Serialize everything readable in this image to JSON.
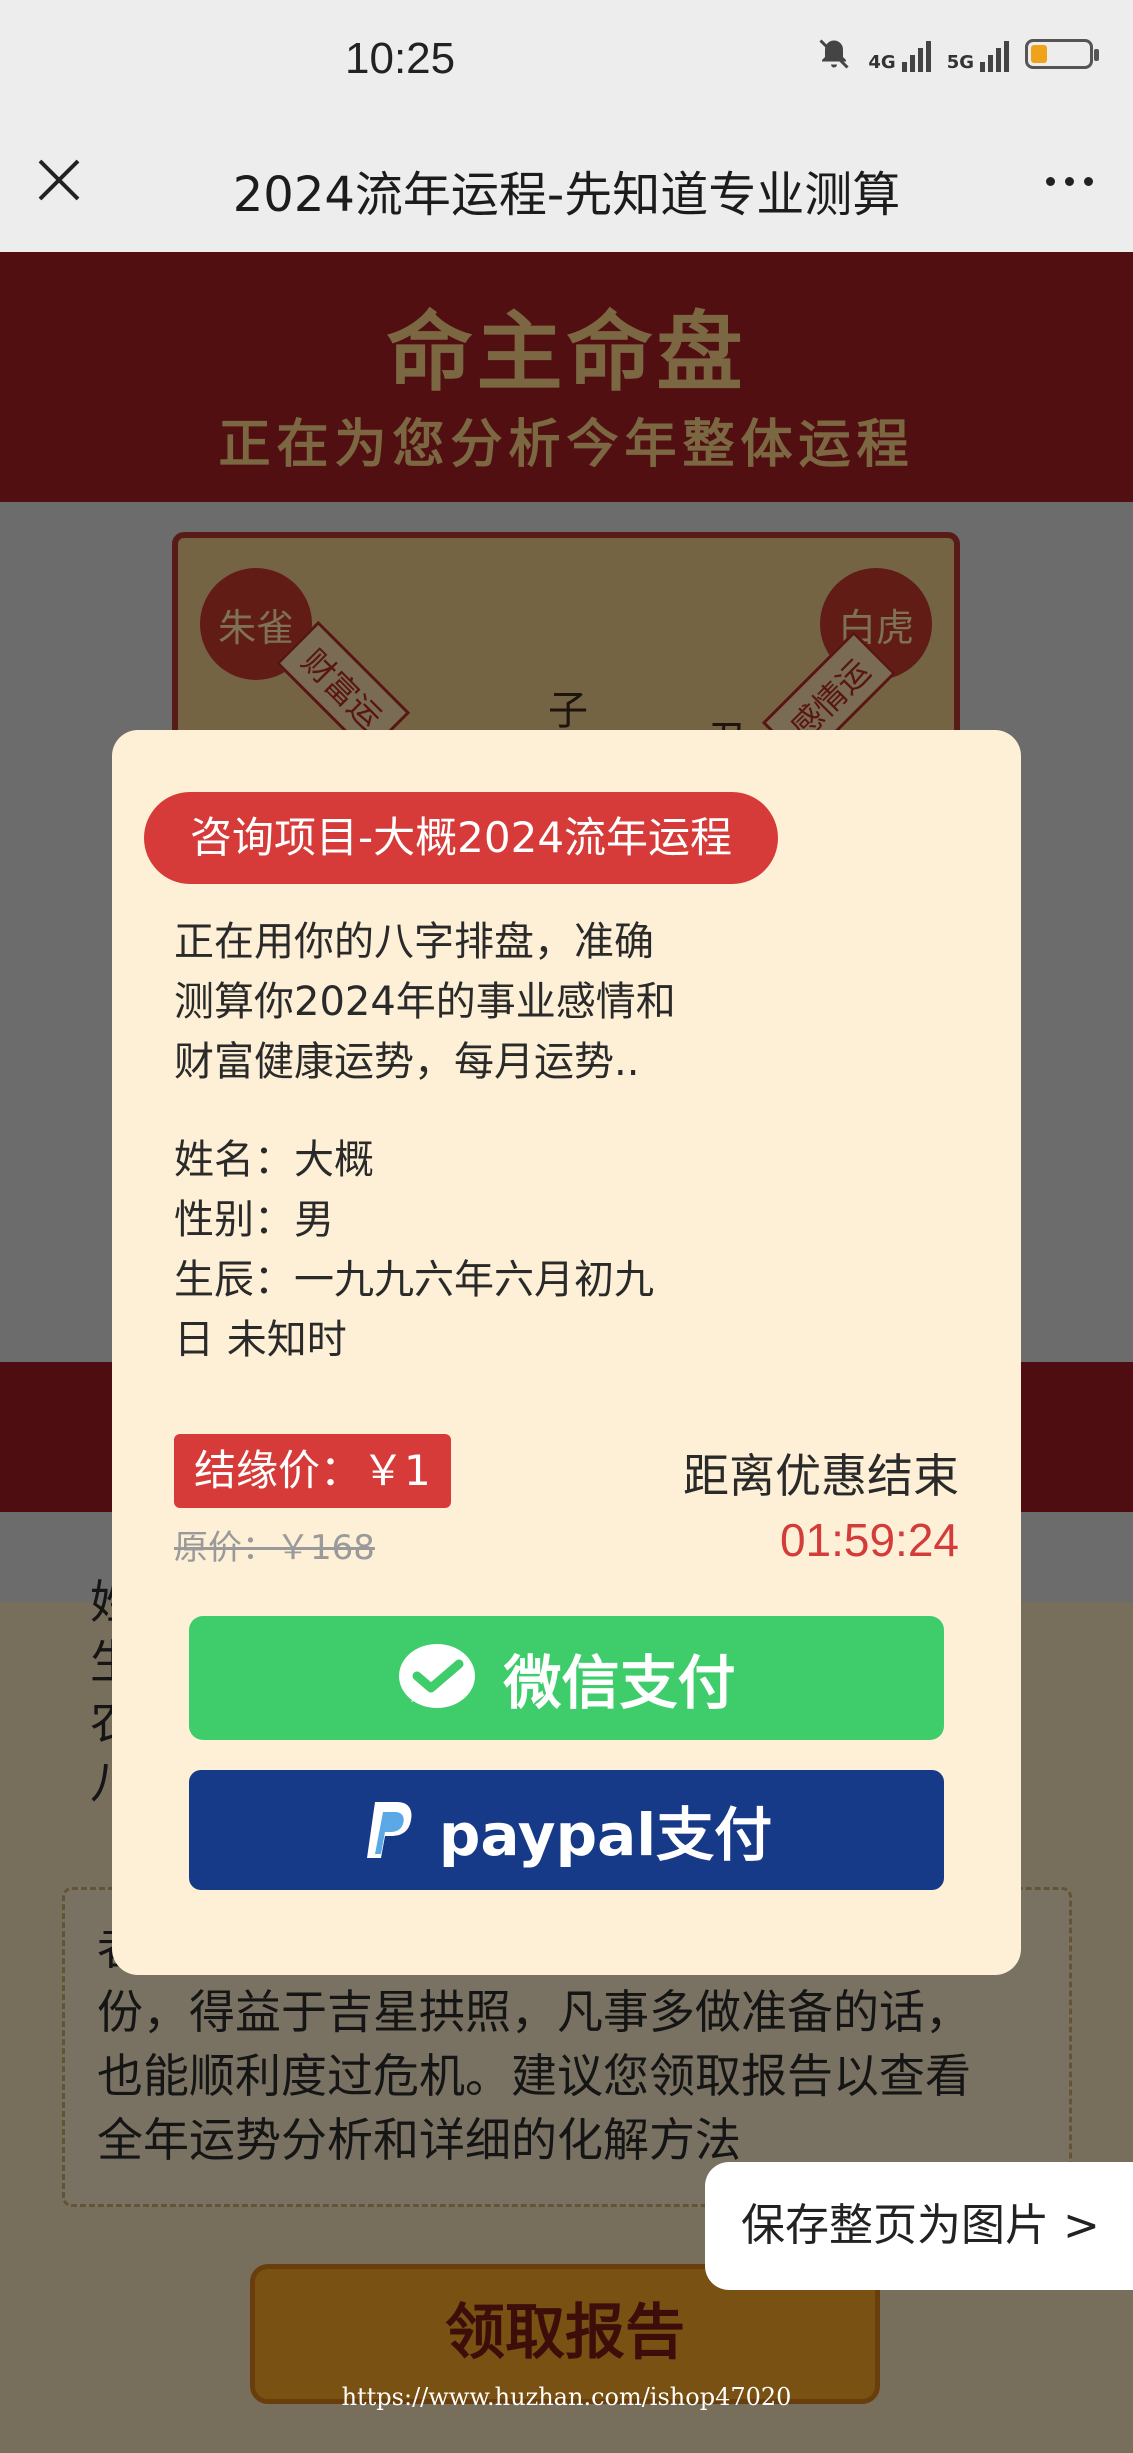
{
  "status_bar": {
    "time": "10:25",
    "network_1": "4G",
    "network_2": "5G",
    "battery_level": 0.25,
    "battery_color": "#f1a21b"
  },
  "nav": {
    "title": "2024流年运程-先知道专业测算"
  },
  "background": {
    "header_title": "命主命盘",
    "header_subtitle": "正在为您分析今年整体运程",
    "badge_left": "朱雀",
    "badge_right": "白虎",
    "ribbon_left": "财富运",
    "ribbon_right": "感情运",
    "board_zi": "子",
    "board_chou": "丑",
    "text_lines": [
      "姓",
      "生",
      "农",
      "八"
    ],
    "box_lines": [
      "者",
      "份，得益于吉星拱照，凡事多做准备的话，",
      "也能顺利度过危机。建议您领取报告以查看",
      "全年运势分析和详细的化解方法"
    ],
    "report_button": "领取报告"
  },
  "modal": {
    "tag": "咨询项目-大概2024流年运程",
    "desc_lines": [
      "正在用你的八字排盘，准确",
      "测算你2024年的事业感情和",
      "财富健康运势，每月运势.."
    ],
    "info_lines": [
      "姓名：大概",
      "性别：男",
      "生辰：一九九六年六月初九",
      "日 未知时"
    ],
    "price_label": "结缘价：￥1",
    "original_price": "原价：￥168",
    "countdown_label": "距离优惠结束",
    "countdown_time": "01:59:24",
    "wechat_pay": "微信支付",
    "paypal_pay": "paypal支付",
    "accent_red": "#d63b39",
    "wechat_green": "#3fcc6a",
    "paypal_blue": "#163a87"
  },
  "floating": {
    "save_button": "保存整页为图片 >"
  },
  "watermark": "https://www.huzhan.com/ishop47020"
}
